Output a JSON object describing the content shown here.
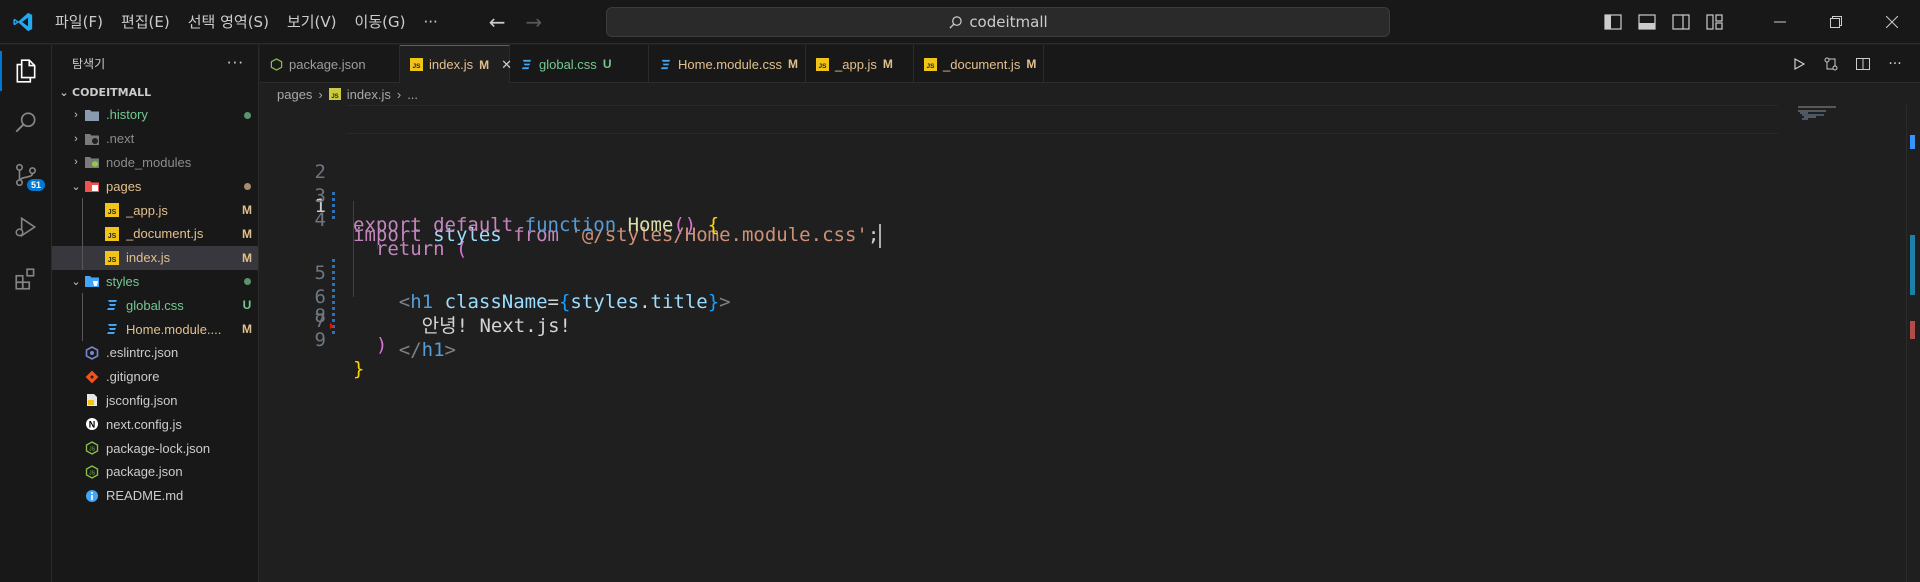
{
  "titlebar": {
    "menu": [
      "파일(F)",
      "편집(E)",
      "선택 영역(S)",
      "보기(V)",
      "이동(G)",
      "···"
    ],
    "search_text": "codeitmall"
  },
  "activity": {
    "scm_badge": "51"
  },
  "explorer": {
    "title": "탐색기",
    "more": "···",
    "root": "CODEITMALL",
    "items": [
      {
        "name": ".history",
        "type": "folder",
        "status": "dot",
        "color": "#73c991"
      },
      {
        "name": ".next",
        "type": "folder",
        "status": "",
        "color": "#8c8c8c"
      },
      {
        "name": "node_modules",
        "type": "folder",
        "status": "",
        "color": "#8c8c8c"
      },
      {
        "name": "pages",
        "type": "folder",
        "status": "dot",
        "color": "#e2c08d"
      },
      {
        "name": "_app.js",
        "type": "file",
        "status": "M",
        "color": "#e2c08d"
      },
      {
        "name": "_document.js",
        "type": "file",
        "status": "M",
        "color": "#e2c08d"
      },
      {
        "name": "index.js",
        "type": "file",
        "status": "M",
        "color": "#e2c08d"
      },
      {
        "name": "styles",
        "type": "folder",
        "status": "dot",
        "color": "#73c991"
      },
      {
        "name": "global.css",
        "type": "file",
        "status": "U",
        "color": "#73c991"
      },
      {
        "name": "Home.module....",
        "type": "file",
        "status": "M",
        "color": "#e2c08d"
      },
      {
        "name": ".eslintrc.json",
        "type": "file",
        "status": "",
        "color": "#cccccc"
      },
      {
        "name": ".gitignore",
        "type": "file",
        "status": "",
        "color": "#cccccc"
      },
      {
        "name": "jsconfig.json",
        "type": "file",
        "status": "",
        "color": "#cccccc"
      },
      {
        "name": "next.config.js",
        "type": "file",
        "status": "",
        "color": "#cccccc"
      },
      {
        "name": "package-lock.json",
        "type": "file",
        "status": "",
        "color": "#cccccc"
      },
      {
        "name": "package.json",
        "type": "file",
        "status": "",
        "color": "#cccccc"
      },
      {
        "name": "README.md",
        "type": "file",
        "status": "",
        "color": "#cccccc"
      }
    ]
  },
  "tabs": [
    {
      "name": "package.json",
      "status": "",
      "color": "#9d9d9d"
    },
    {
      "name": "index.js",
      "status": "M",
      "color": "#e2c08d"
    },
    {
      "name": "global.css",
      "status": "U",
      "color": "#73c991"
    },
    {
      "name": "Home.module.css",
      "status": "M",
      "color": "#e2c08d"
    },
    {
      "name": "_app.js",
      "status": "M",
      "color": "#e2c08d"
    },
    {
      "name": "_document.js",
      "status": "M",
      "color": "#e2c08d"
    }
  ],
  "breadcrumb": {
    "folder": "pages",
    "file": "index.js",
    "symbol": "..."
  },
  "code": {
    "line_numbers": [
      "1",
      "2",
      "3",
      "4",
      "5",
      "6",
      "7",
      "8",
      "9"
    ],
    "l1": {
      "import": "import",
      "styles": "styles",
      "from": "from",
      "path": "'@/styles/Home.module.css'",
      "semi": ";"
    },
    "l3": {
      "export": "export",
      "default": "default",
      "function": "function",
      "name": "Home",
      "parens": "()",
      "brace": "{"
    },
    "l4": {
      "return": "return",
      "paren": "("
    },
    "l5": {
      "lt": "<",
      "tag": "h1",
      "attr": "className",
      "eq": "=",
      "lbrace": "{",
      "expr": "styles",
      "dot": ".",
      "prop": "title",
      "rbrace": "}",
      "gt": ">"
    },
    "l6": {
      "text": "안녕! Next.js!"
    },
    "l7": {
      "open": "</",
      "tag": "h1",
      "gt": ">"
    },
    "l8": {
      "paren": ")"
    },
    "l9": {
      "brace": "}"
    }
  },
  "colors": {
    "accent": "#0078d4",
    "modified": "#e2c08d",
    "untracked": "#73c991"
  }
}
